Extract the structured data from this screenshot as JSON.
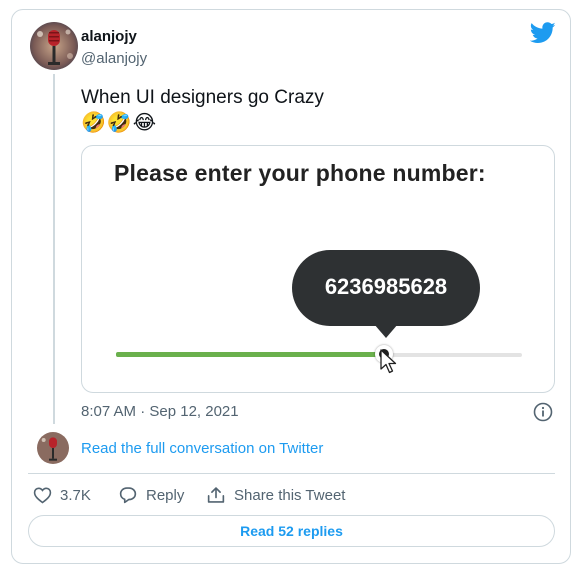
{
  "tweet": {
    "display_name": "alanjojy",
    "handle": "@alanjojy",
    "text": "When UI designers go Crazy",
    "emojis": "🤣🤣😂",
    "timestamp": "8:07 AM · Sep 12, 2021"
  },
  "media": {
    "prompt": "Please enter your phone number:",
    "bubble_value": "6236985628",
    "slider_fill_fraction": 0.66,
    "accent_color": "#6ab04c"
  },
  "footer": {
    "full_conversation": "Read the full conversation on Twitter",
    "like_count": "3.7K",
    "reply_label": "Reply",
    "share_label": "Share this Tweet",
    "read_replies": "Read 52 replies"
  },
  "colors": {
    "link": "#1d9bf0",
    "secondary_text": "#536471",
    "border": "#cfd9de"
  }
}
